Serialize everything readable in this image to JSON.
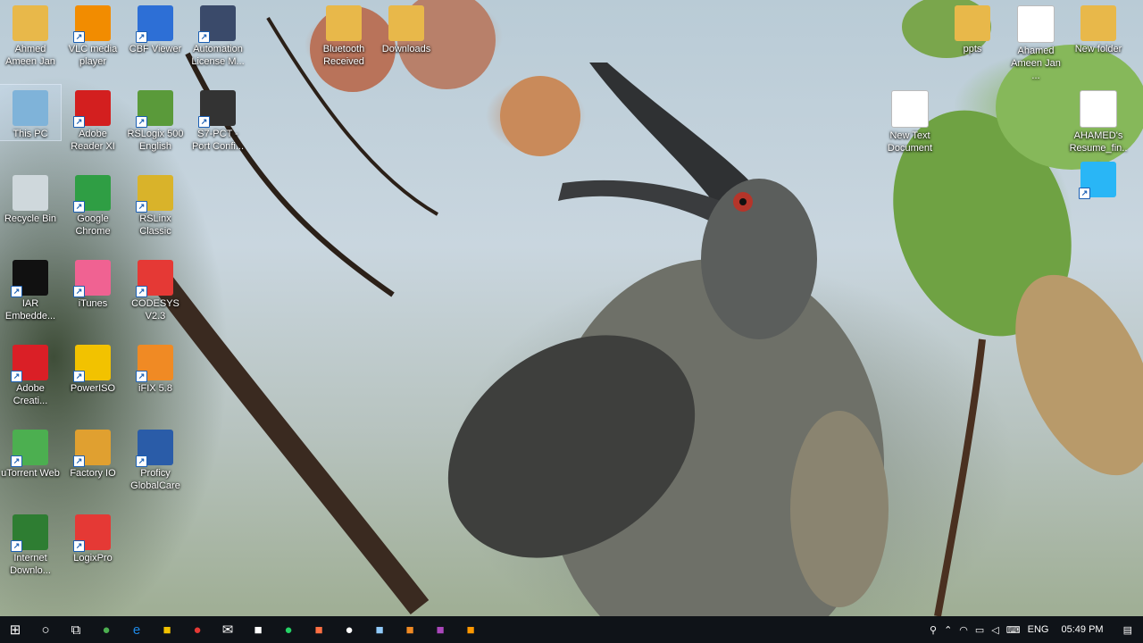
{
  "desktop_icons": [
    {
      "label": "Ahmed Ameen Jan",
      "icon": "user-folder-icon",
      "color": "#e8b84a"
    },
    {
      "label": "VLC media player",
      "icon": "vlc-icon",
      "color": "#f28c00"
    },
    {
      "label": "CBF Viewer",
      "icon": "cbf-viewer-icon",
      "color": "#2d6fd6"
    },
    {
      "label": "Automation License M...",
      "icon": "license-manager-icon",
      "color": "#3a4a6a"
    },
    {
      "label": "This PC",
      "icon": "computer-icon",
      "color": "#7fb3d9"
    },
    {
      "label": "Adobe Reader XI",
      "icon": "adobe-reader-icon",
      "color": "#d31f1f"
    },
    {
      "label": "RSLogix 500 English",
      "icon": "rslogix-icon",
      "color": "#5a9a3a"
    },
    {
      "label": "S7-PCT - Port Confi...",
      "icon": "s7-pct-icon",
      "color": "#333333"
    },
    {
      "label": "Recycle Bin",
      "icon": "recycle-bin-icon",
      "color": "#cfd8dc"
    },
    {
      "label": "Google Chrome",
      "icon": "chrome-icon",
      "color": "#2f9e44"
    },
    {
      "label": "RSLinx Classic",
      "icon": "rslinx-icon",
      "color": "#d9b32a"
    },
    {
      "label": "IAR Embedde...",
      "icon": "iar-icon",
      "color": "#111111"
    },
    {
      "label": "iTunes",
      "icon": "itunes-icon",
      "color": "#f06292"
    },
    {
      "label": "CODESYS V2.3",
      "icon": "codesys-icon",
      "color": "#e53935"
    },
    {
      "label": "Adobe Creati...",
      "icon": "creative-cloud-icon",
      "color": "#da1f26"
    },
    {
      "label": "PowerISO",
      "icon": "poweriso-icon",
      "color": "#f2c200"
    },
    {
      "label": "iFIX 5.8",
      "icon": "ifix-icon",
      "color": "#f08a24"
    },
    {
      "label": "uTorrent Web",
      "icon": "utorrent-icon",
      "color": "#4caf50"
    },
    {
      "label": "Factory IO",
      "icon": "factory-io-icon",
      "color": "#e0a030"
    },
    {
      "label": "Proficy GlobalCare",
      "icon": "proficy-icon",
      "color": "#2a5ca8"
    },
    {
      "label": "Internet Downlo...",
      "icon": "idm-icon",
      "color": "#2e7d32"
    },
    {
      "label": "LogixPro",
      "icon": "logixpro-icon",
      "color": "#e53935"
    },
    {
      "label": "Bluetooth Received",
      "icon": "bluetooth-folder-icon",
      "color": "#e8b84a"
    },
    {
      "label": "Downloads",
      "icon": "downloads-folder-icon",
      "color": "#e8b84a"
    },
    {
      "label": "ppts",
      "icon": "folder-icon",
      "color": "#e8b84a"
    },
    {
      "label": "Ahamed Ameen Jan ...",
      "icon": "pdf-icon",
      "color": "#ffffff"
    },
    {
      "label": "New folder",
      "icon": "folder-icon",
      "color": "#e8b84a"
    },
    {
      "label": "New Text Document",
      "icon": "text-document-icon",
      "color": "#ffffff"
    },
    {
      "label": "AHAMED's Resume_fin...",
      "icon": "pdf-icon",
      "color": "#ffffff"
    },
    {
      "label": "",
      "icon": "app-shortcut-icon",
      "color": "#29b6f6"
    }
  ],
  "taskbar": {
    "items": [
      {
        "name": "start",
        "glyph": "⊞"
      },
      {
        "name": "search",
        "glyph": "○"
      },
      {
        "name": "task-view",
        "glyph": "⧉"
      },
      {
        "name": "app-globe",
        "glyph": "●",
        "color": "#4caf50"
      },
      {
        "name": "edge",
        "glyph": "e",
        "color": "#1e88e5"
      },
      {
        "name": "file-explorer",
        "glyph": "■",
        "color": "#f2c200"
      },
      {
        "name": "chrome",
        "glyph": "●",
        "color": "#e53935"
      },
      {
        "name": "mail",
        "glyph": "✉",
        "color": "#ffffff"
      },
      {
        "name": "store",
        "glyph": "■",
        "color": "#ffffff"
      },
      {
        "name": "whatsapp",
        "glyph": "●",
        "color": "#25d366"
      },
      {
        "name": "app-orange",
        "glyph": "■",
        "color": "#ff7043"
      },
      {
        "name": "maps",
        "glyph": "●",
        "color": "#ffffff"
      },
      {
        "name": "notepad",
        "glyph": "■",
        "color": "#90caf9"
      },
      {
        "name": "ifix",
        "glyph": "■",
        "color": "#f08a24"
      },
      {
        "name": "app-multicolor",
        "glyph": "■",
        "color": "#ab47bc"
      },
      {
        "name": "app-orange-2",
        "glyph": "■",
        "color": "#ff9800"
      }
    ],
    "tray": {
      "language": "ENG",
      "time": "05:49 PM"
    }
  }
}
